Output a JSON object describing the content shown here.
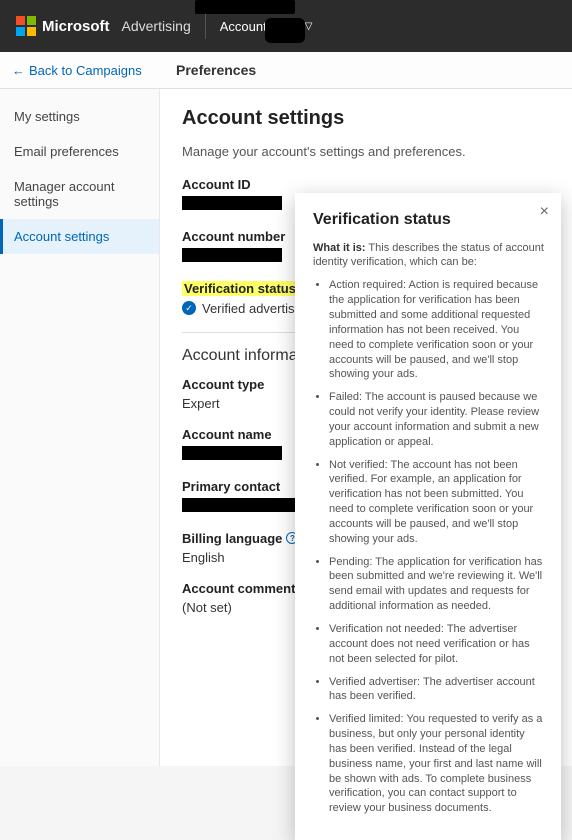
{
  "header": {
    "brand": "Microsoft",
    "product": "Advertising",
    "account_switcher": "Account"
  },
  "subheader": {
    "back": "Back to Campaigns",
    "title": "Preferences"
  },
  "sidebar": {
    "items": [
      {
        "label": "My settings"
      },
      {
        "label": "Email preferences"
      },
      {
        "label": "Manager account settings"
      },
      {
        "label": "Account settings"
      }
    ]
  },
  "main": {
    "title": "Account settings",
    "lead": "Manage your account's settings and preferences.",
    "fields": {
      "account_id_label": "Account ID",
      "account_number_label": "Account number",
      "verification_status_label": "Verification status",
      "verified_value": "Verified advertiser",
      "info_section": "Account informat",
      "account_type_label": "Account type",
      "account_type_value": "Expert",
      "account_name_label": "Account name",
      "primary_contact_label": "Primary contact",
      "billing_language_label": "Billing language",
      "billing_language_value": "English",
      "account_comments_label": "Account comments",
      "account_comments_value": "(Not set)"
    }
  },
  "popover": {
    "title": "Verification status",
    "intro_bold": "What it is:",
    "intro_rest": " This describes the status of account identity verification, which can be:",
    "items": [
      "Action required: Action is required because the application for verification has been submitted and some additional requested information has not been received. You need to complete verification soon or your accounts will be paused, and we'll stop showing your ads.",
      "Failed: The account is paused because we could not verify your identity. Please review your account information and submit a new application or appeal.",
      "Not verified: The account has not been verified. For example, an application for verification has not been submitted. You need to complete verification soon or your accounts will be paused, and we'll stop showing your ads.",
      "Pending: The application for verification has been submitted and we're reviewing it. We'll send email with updates and requests for additional information as needed.",
      "Verification not needed: The advertiser account does not need verification or has not been selected for pilot.",
      "Verified advertiser: The advertiser account has been verified.",
      "Verified limited: You requested to verify as a business, but only your personal identity has been verified. Instead of the legal business name, your first and last name will be shown with ads. To complete business verification, you can contact support to review your business documents."
    ]
  }
}
